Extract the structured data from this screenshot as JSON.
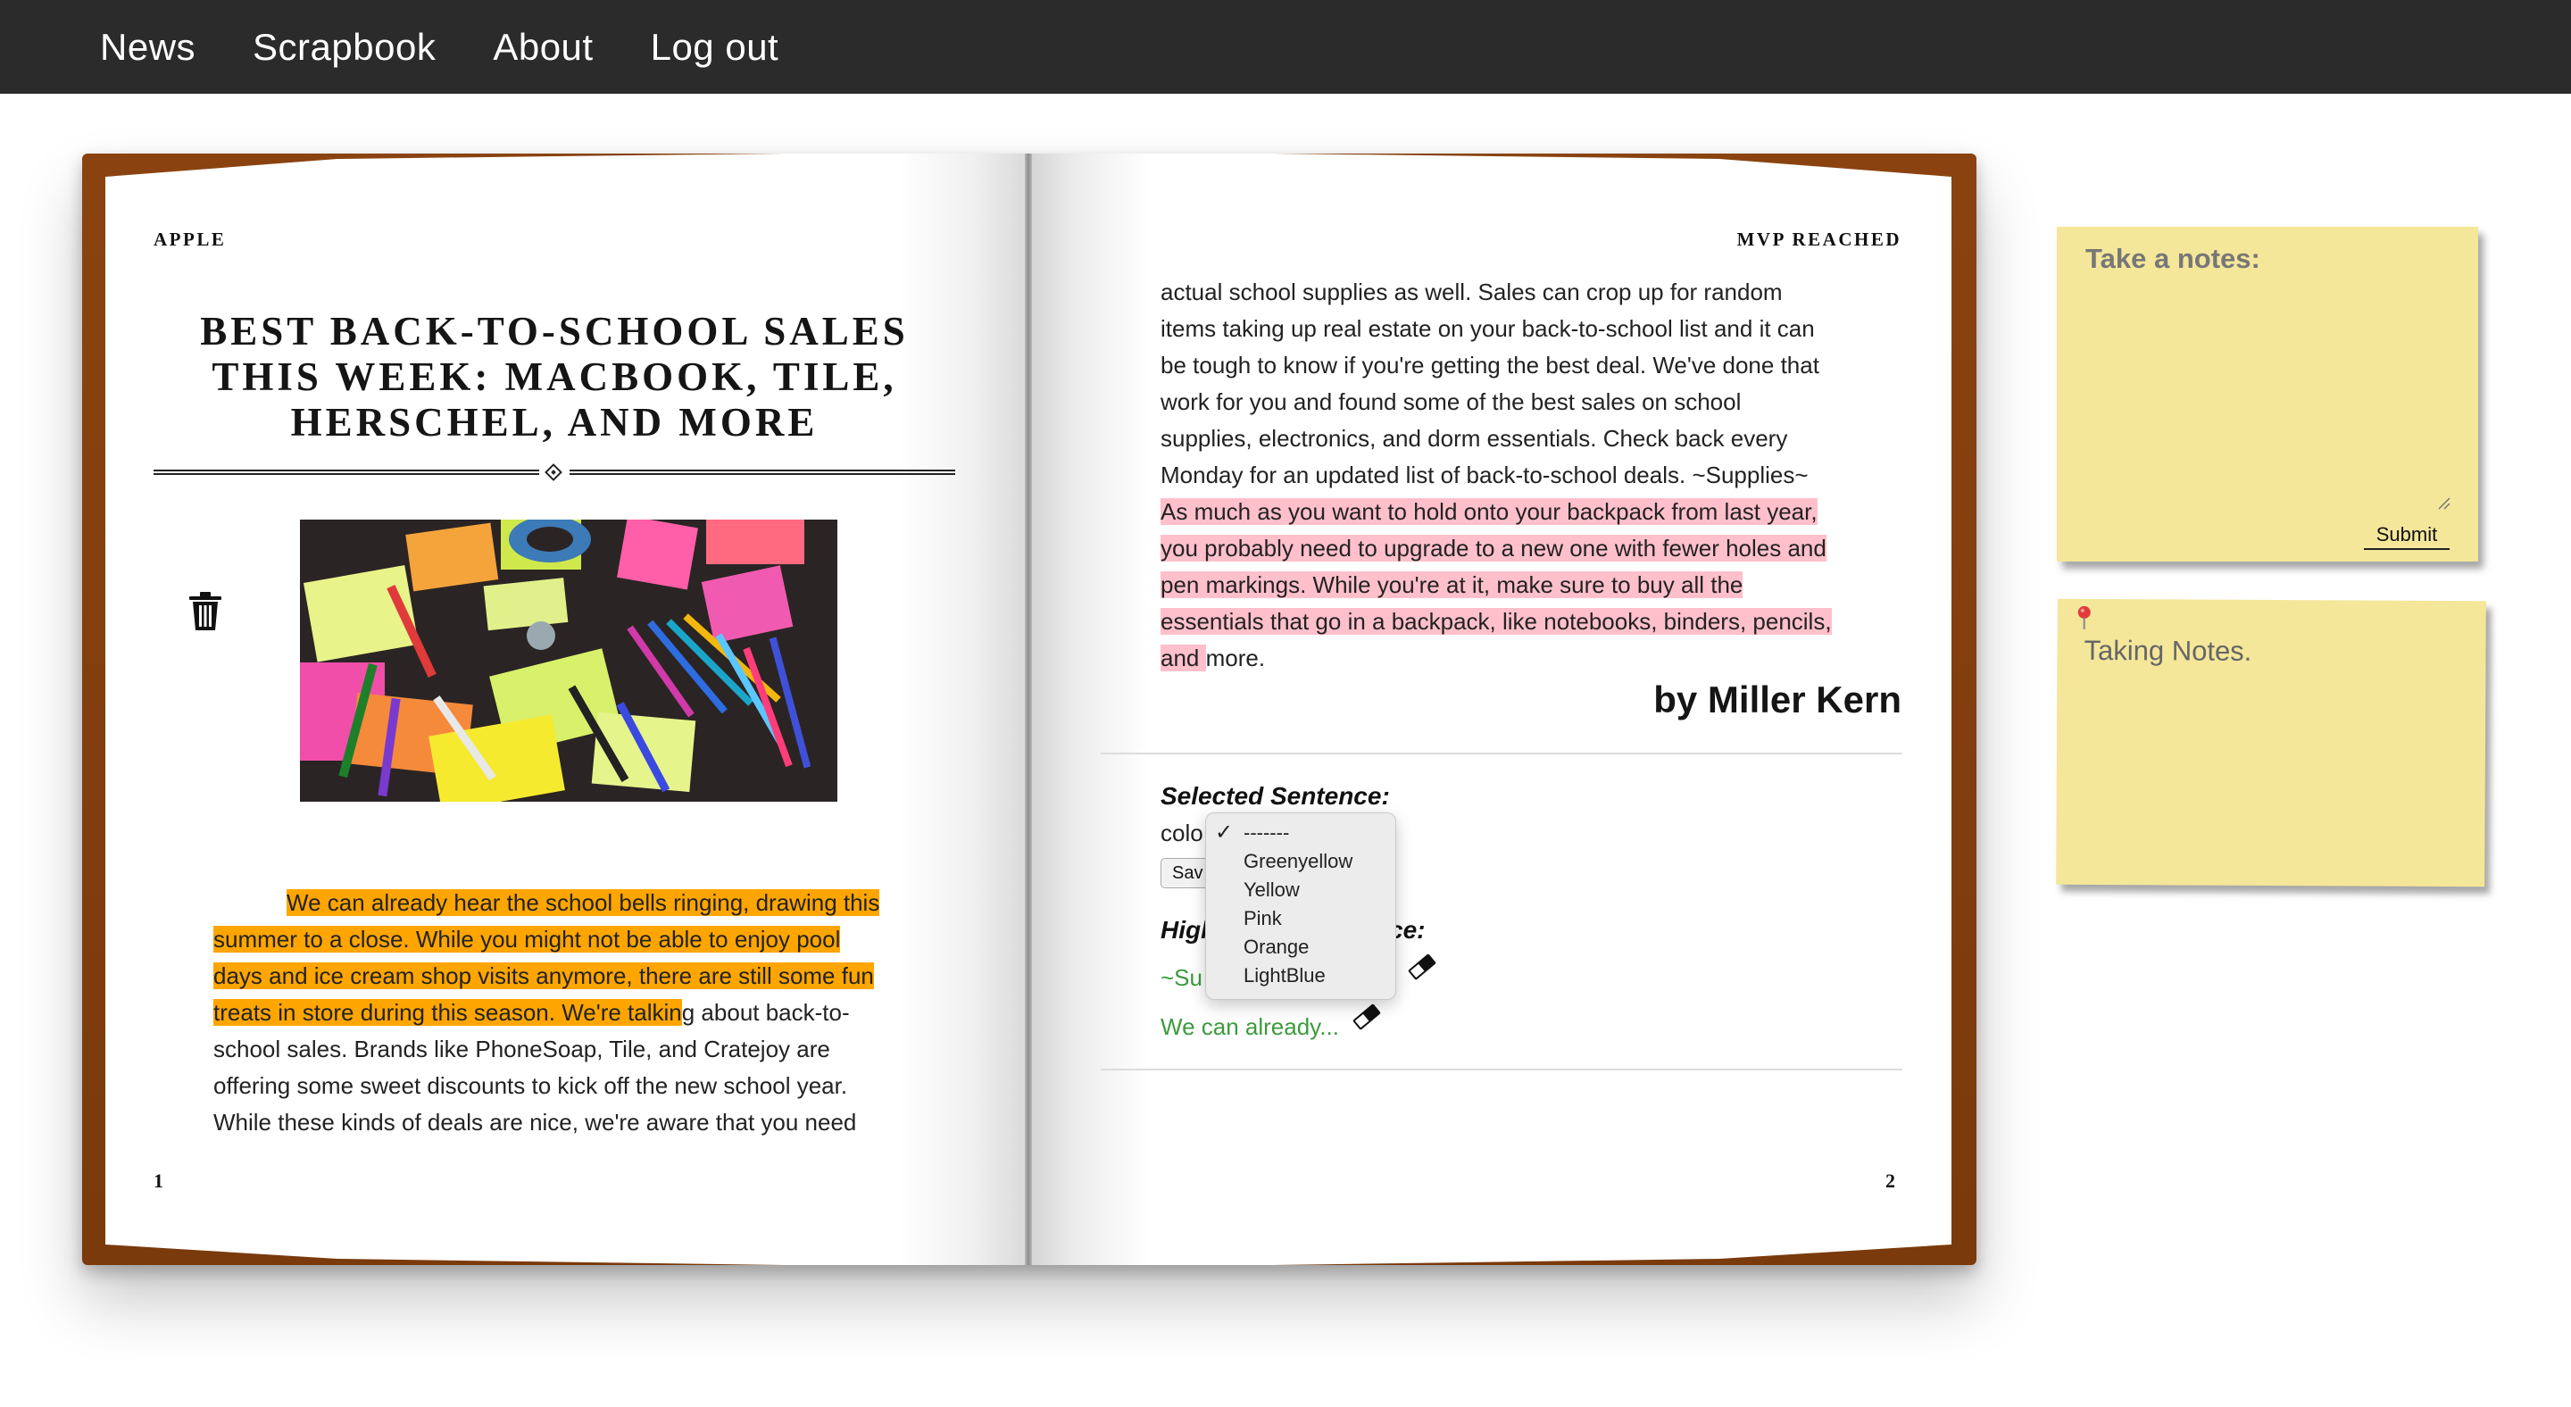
{
  "nav": {
    "items": [
      "News",
      "Scrapbook",
      "About",
      "Log out"
    ]
  },
  "book": {
    "left_page": {
      "running_head": "APPLE",
      "title": "Best Back-to-School Sales This Week: MacBook, Tile, Herschel, and More",
      "image_alt": "Colorful sticky notes, markers and pens on a dark desk",
      "body_highlighted": "We can already hear the school bells ringing, drawing this summer to a close. While you might not be able to enjoy pool days and ice cream shop visits anymore, there are still some fun treats in store during this season. We're talkin",
      "body_rest": "g about back-to-school sales. Brands like PhoneSoap, Tile, and Cratejoy are offering some sweet discounts to kick off the new school year. While these kinds of deals are nice, we're aware that you need",
      "page_number": "1"
    },
    "right_page": {
      "running_head": "MVP REACHED",
      "body_plain": "actual school supplies as well. Sales can crop up for random items taking up real estate on your back-to-school list and it can be tough to know if you're getting the best deal. We've done that work for you and found some of the best sales on school supplies, electronics, and dorm essentials. Check back every Monday for an updated list of back-to-school deals. ~Supplies~ ",
      "body_highlighted": "As much as you want to hold onto your backpack from last year, you probably need to upgrade to a new one with fewer holes and pen markings. While you're at it, make sure to buy all the essentials that go in a backpack, like notebooks, binders, pencils, and ",
      "body_tail": "more.",
      "byline": "by Miller Kern",
      "selected_sentence_label": "Selected Sentence:",
      "color_label": "colo",
      "save_label": "Sav",
      "highlight_label_start": "Higl",
      "highlight_label_end": "ce:",
      "highlights": [
        "~Su",
        "We can already..."
      ],
      "page_number": "2"
    },
    "dropdown": {
      "selected": "-------",
      "options": [
        "-------",
        "Greenyellow",
        "Yellow",
        "Pink",
        "Orange",
        "LightBlue"
      ]
    }
  },
  "notes": {
    "form_heading": "Take a notes:",
    "submit_label": "Submit",
    "saved_note": "Taking Notes."
  },
  "colors": {
    "navbar": "#2b2b2b",
    "book_cover": "#7a3a0c",
    "highlight_orange": "#ffa500",
    "highlight_pink": "#ffc0cb",
    "highlight_link": "#3c9b3c",
    "sticky_note": "#f4e79a"
  },
  "icons": {
    "delete": "trash-icon",
    "erase": "eraser-icon",
    "pin": "pushpin-icon",
    "check": "checkmark-icon"
  }
}
